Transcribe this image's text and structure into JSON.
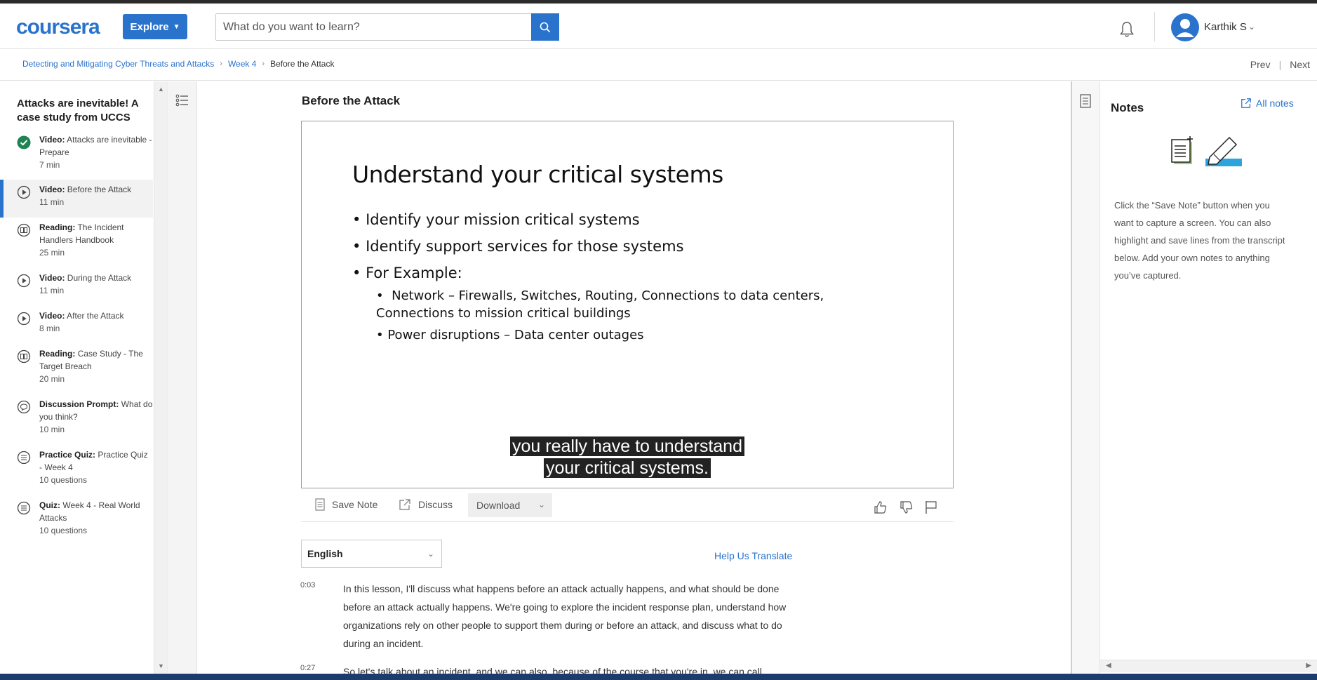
{
  "header": {
    "logo": "coursera",
    "explore_label": "Explore",
    "search_placeholder": "What do you want to learn?",
    "user_name": "Karthik S",
    "brand_color": "#2a73cc"
  },
  "breadcrumb": {
    "course": "Detecting and Mitigating Cyber Threats and Attacks",
    "week": "Week 4",
    "current": "Before the Attack",
    "prev_label": "Prev",
    "next_label": "Next"
  },
  "sidebar": {
    "title": "Attacks are inevitable! A case study from UCCS",
    "items": [
      {
        "kind": "Video:",
        "title": "Attacks are inevitable - Prepare",
        "duration": "7 min",
        "icon": "completed-check-icon",
        "active": false
      },
      {
        "kind": "Video:",
        "title": "Before the Attack",
        "duration": "11 min",
        "icon": "play-icon",
        "active": true
      },
      {
        "kind": "Reading:",
        "title": "The Incident Handlers Handbook",
        "duration": "25 min",
        "icon": "reading-icon",
        "active": false
      },
      {
        "kind": "Video:",
        "title": "During the Attack",
        "duration": "11 min",
        "icon": "play-icon",
        "active": false
      },
      {
        "kind": "Video:",
        "title": "After the Attack",
        "duration": "8 min",
        "icon": "play-icon",
        "active": false
      },
      {
        "kind": "Reading:",
        "title": "Case Study - The Target Breach",
        "duration": "20 min",
        "icon": "reading-icon",
        "active": false
      },
      {
        "kind": "Discussion Prompt:",
        "title": "What do you think?",
        "duration": "10 min",
        "icon": "discussion-icon",
        "active": false
      },
      {
        "kind": "Practice Quiz:",
        "title": "Practice Quiz - Week 4",
        "duration": "10 questions",
        "icon": "quiz-icon",
        "active": false
      },
      {
        "kind": "Quiz:",
        "title": "Week 4 - Real World Attacks",
        "duration": "10 questions",
        "icon": "quiz-icon",
        "active": false
      }
    ]
  },
  "main": {
    "lesson_title": "Before the Attack",
    "slide": {
      "title": "Understand your critical systems",
      "bullets": [
        "Identify your mission critical systems",
        "Identify support services for those systems",
        "For Example:"
      ],
      "sub_bullets": [
        "Network – Firewalls, Switches, Routing, Connections to data centers, Connections to mission critical buildings",
        "Power disruptions – Data center outages"
      ]
    },
    "caption_line1": "you really have to understand",
    "caption_line2": "your critical systems.",
    "toolbar": {
      "save_note": "Save Note",
      "discuss": "Discuss",
      "download": "Download"
    },
    "language": "English",
    "help_translate": "Help Us Translate",
    "transcript": [
      {
        "time": "0:03",
        "text": "In this lesson, I'll discuss what happens before an attack actually happens, and what should be done before an attack actually happens. We're going to explore the incident response plan, understand how organizations rely on other people to support them during or before an attack, and discuss what to do during an incident."
      },
      {
        "time": "0:27",
        "text": "So let's talk about an incident, and we can also, because of the course that you're in, we can call"
      }
    ]
  },
  "notes": {
    "title": "Notes",
    "all_notes": "All notes",
    "description": "Click the “Save Note” button when you want to capture a screen. You can also highlight and save lines from the transcript below. Add your own notes to anything you’ve captured."
  }
}
